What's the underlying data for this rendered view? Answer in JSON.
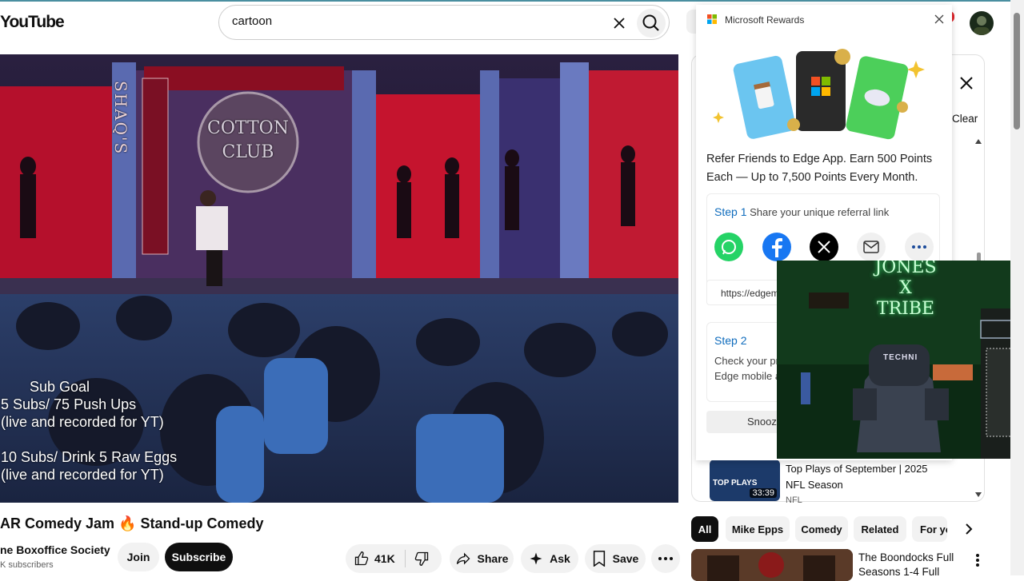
{
  "header": {
    "logo": "YouTube",
    "search_value": "cartoon"
  },
  "video": {
    "overlay": {
      "heading": "Sub Goal",
      "line1": "5 Subs/ 75 Push Ups",
      "line2": "(live and recorded for YT)",
      "line3": "10 Subs/ Drink 5 Raw Eggs",
      "line4": "(live and recorded for YT)"
    },
    "stage_sign_1": "SHAQ'S",
    "stage_sign_2": "COTTON CLUB",
    "title": "AR Comedy Jam 🔥 Stand-up Comedy",
    "channel": "ne Boxoffice Society",
    "subscribers": "K subscribers",
    "join_label": "Join",
    "subscribe_label": "Subscribe",
    "like_count": "41K",
    "share_label": "Share",
    "ask_label": "Ask",
    "save_label": "Save"
  },
  "side_panel": {
    "clear_label": "Clear"
  },
  "rewards": {
    "title": "Microsoft Rewards",
    "body": "Refer Friends to Edge App. Earn 500 Points Each — Up to 7,500 Points Every Month.",
    "step1_label": "Step 1",
    "step1_text": "Share your unique referral link",
    "link_preview": "https://edgem",
    "step2_label": "Step 2",
    "step2_text": "Check your pr",
    "step2_text2": "Edge mobile a",
    "snooze_label": "Snooze"
  },
  "webcam": {
    "neon_line1": "JONES",
    "neon_line2": "X",
    "neon_line3": "TRIBE",
    "chair_text": "TECHNI"
  },
  "recommendations": [
    {
      "title": "Top Plays of September | 2025 NFL Season",
      "title_l1": "Top Plays of September | 2025",
      "title_l2": "NFL Season",
      "channel": "NFL",
      "duration": "33:39",
      "thumb_text": "TOP PLAYS"
    },
    {
      "title_l1": "The Boondocks Full",
      "title_l2": "Seasons 1-4 Full"
    }
  ],
  "chips": [
    "All",
    "Mike Epps",
    "Comedy",
    "Related",
    "For yo"
  ],
  "colors": {
    "accent": "#0f6cbd",
    "subscribe_bg": "#0f0f0f",
    "neon": "#3cff7a",
    "stage_red": "#d0203a"
  }
}
